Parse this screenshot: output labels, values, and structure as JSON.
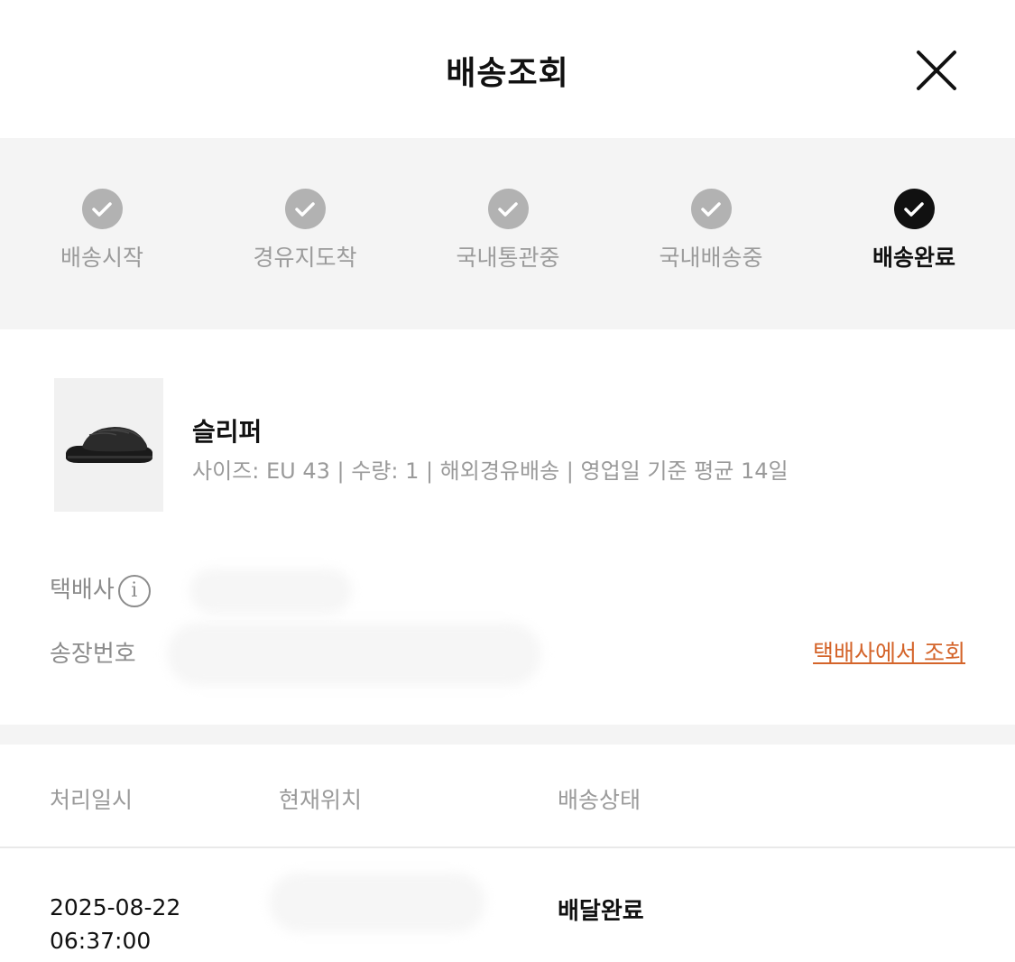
{
  "header": {
    "title": "배송조회",
    "close_icon": "close-icon"
  },
  "steps": [
    {
      "label": "배송시작",
      "icon": "check-icon",
      "active": false
    },
    {
      "label": "경유지도착",
      "icon": "check-icon",
      "active": false
    },
    {
      "label": "국내통관중",
      "icon": "check-icon",
      "active": false
    },
    {
      "label": "국내배송중",
      "icon": "check-icon",
      "active": false
    },
    {
      "label": "배송완료",
      "icon": "check-icon",
      "active": true
    }
  ],
  "product": {
    "name": "슬리퍼",
    "meta": "사이즈: EU 43 | 수량: 1 | 해외경유배송 | 영업일 기준 평균 14일",
    "image_icon": "slipper-image"
  },
  "courier": {
    "label": "택배사",
    "info_icon": "info-icon",
    "info_glyph": "i"
  },
  "tracking": {
    "label": "송장번호",
    "link_label": "택배사에서 조회"
  },
  "history": {
    "headers": [
      "처리일시",
      "현재위치",
      "배송상태"
    ],
    "rows": [
      {
        "date": "2025-08-22",
        "time": "06:37:00",
        "status": "배달완료"
      }
    ]
  },
  "colors": {
    "accent_link": "#d4642a",
    "step_done": "#b2b2b2",
    "step_active": "#111111",
    "band_bg": "#f4f4f4"
  }
}
